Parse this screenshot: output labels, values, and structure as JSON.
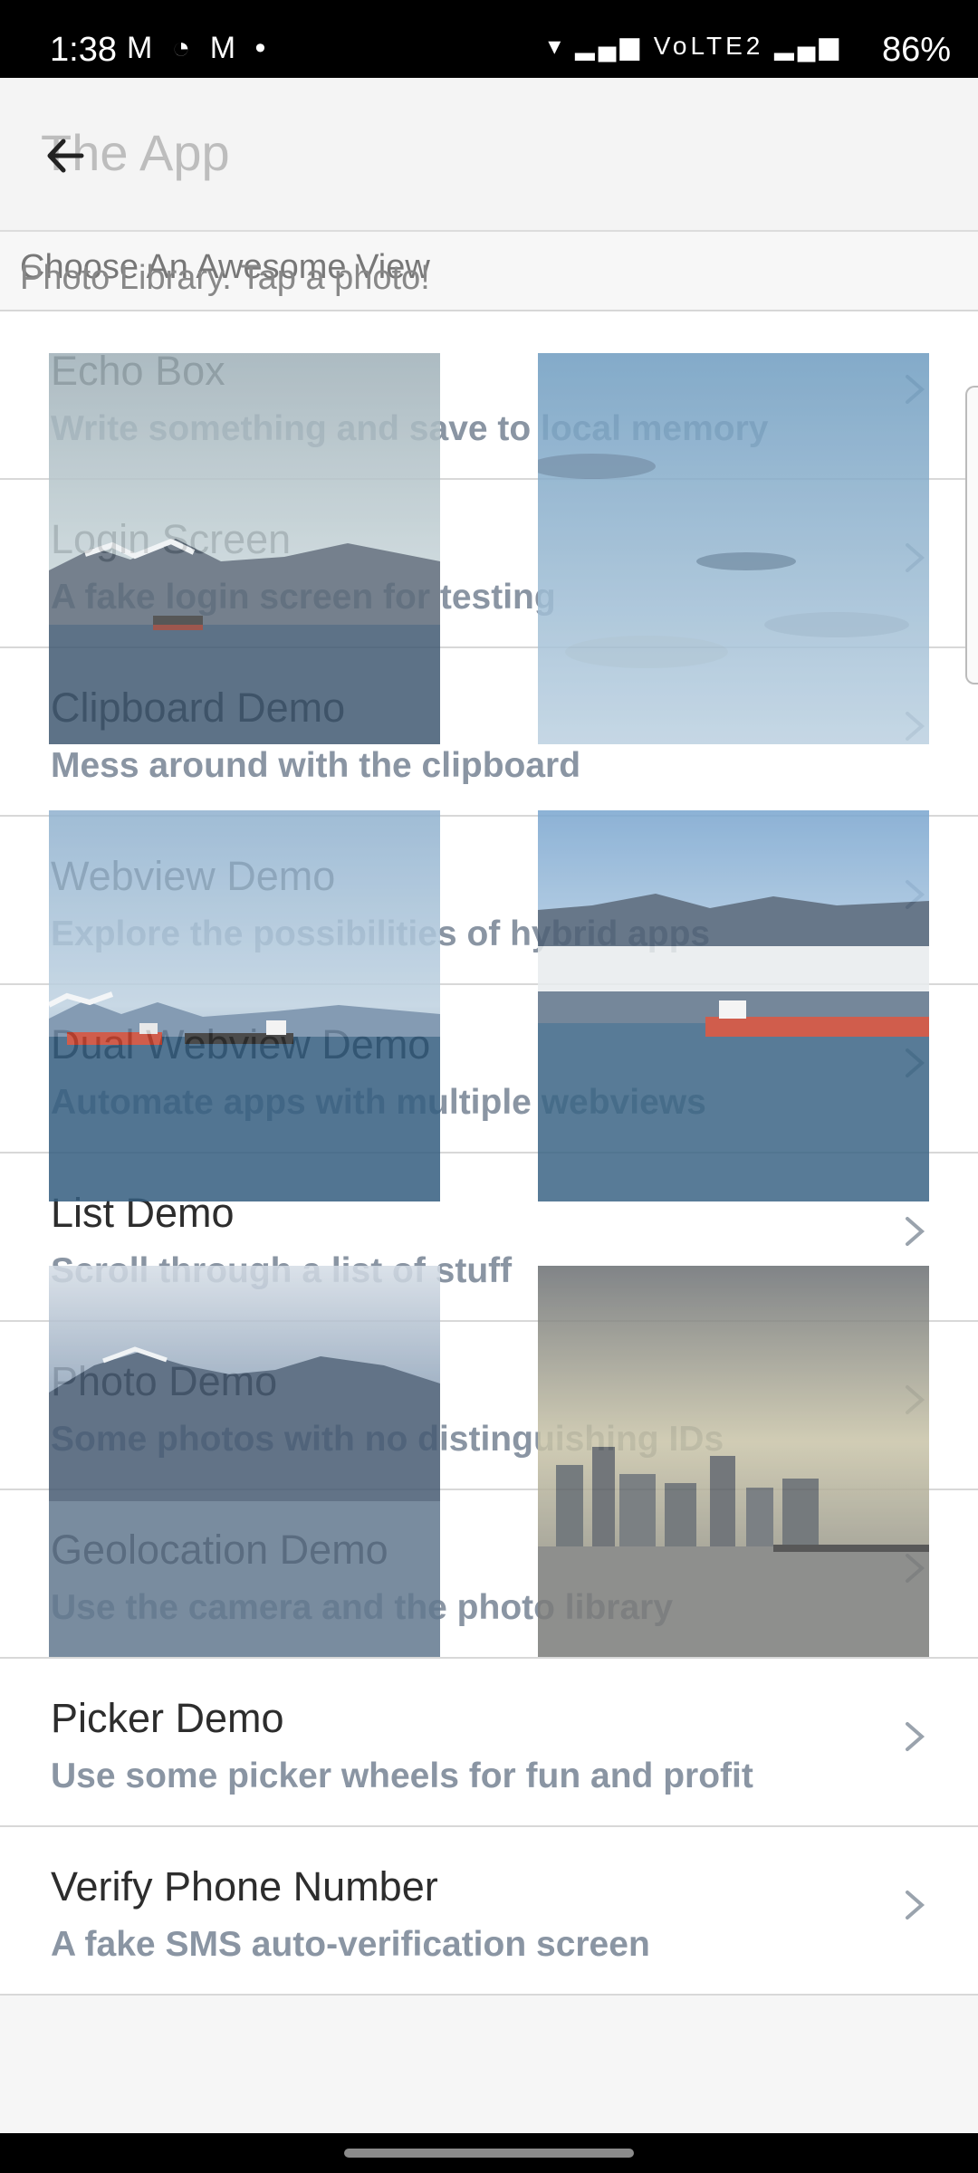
{
  "status": {
    "time": "1:38",
    "notifications": "M ◔ M •",
    "battery": "86%",
    "signal": "▾ ▂▄▆ VoLTE2 ▂▄▆"
  },
  "header": {
    "title": "The App",
    "back_icon": "arrow-left-icon"
  },
  "subheader": {
    "line1": "Choose An Awesome View",
    "line2": "Photo Library. Tap a photo!"
  },
  "list": [
    {
      "title": "Echo Box",
      "subtitle": "Write something and save to local memory"
    },
    {
      "title": "Login Screen",
      "subtitle": "A fake login screen for testing"
    },
    {
      "title": "Clipboard Demo",
      "subtitle": "Mess around with the clipboard"
    },
    {
      "title": "Webview Demo",
      "subtitle": "Explore the possibilities of hybrid apps"
    },
    {
      "title": "Dual Webview Demo",
      "subtitle": "Automate apps with multiple webviews"
    },
    {
      "title": "List Demo",
      "subtitle": "Scroll through a list of stuff"
    },
    {
      "title": "Photo Demo",
      "subtitle": "Some photos with no distinguishing IDs"
    },
    {
      "title": "Geolocation Demo",
      "subtitle": "Use the camera and the photo library"
    },
    {
      "title": "Picker Demo",
      "subtitle": "Use some picker wheels for fun and profit"
    },
    {
      "title": "Verify Phone Number",
      "subtitle": "A fake SMS auto-verification screen"
    }
  ],
  "photos": [
    {
      "name": "photo-mountains-ship"
    },
    {
      "name": "photo-sky-clouds"
    },
    {
      "name": "photo-ships-harbor"
    },
    {
      "name": "photo-red-freighter"
    },
    {
      "name": "photo-mountain-city"
    },
    {
      "name": "photo-city-skyline"
    }
  ],
  "colors": {
    "accent_text": "#8a95a3",
    "title_text": "#2d2d2d"
  }
}
